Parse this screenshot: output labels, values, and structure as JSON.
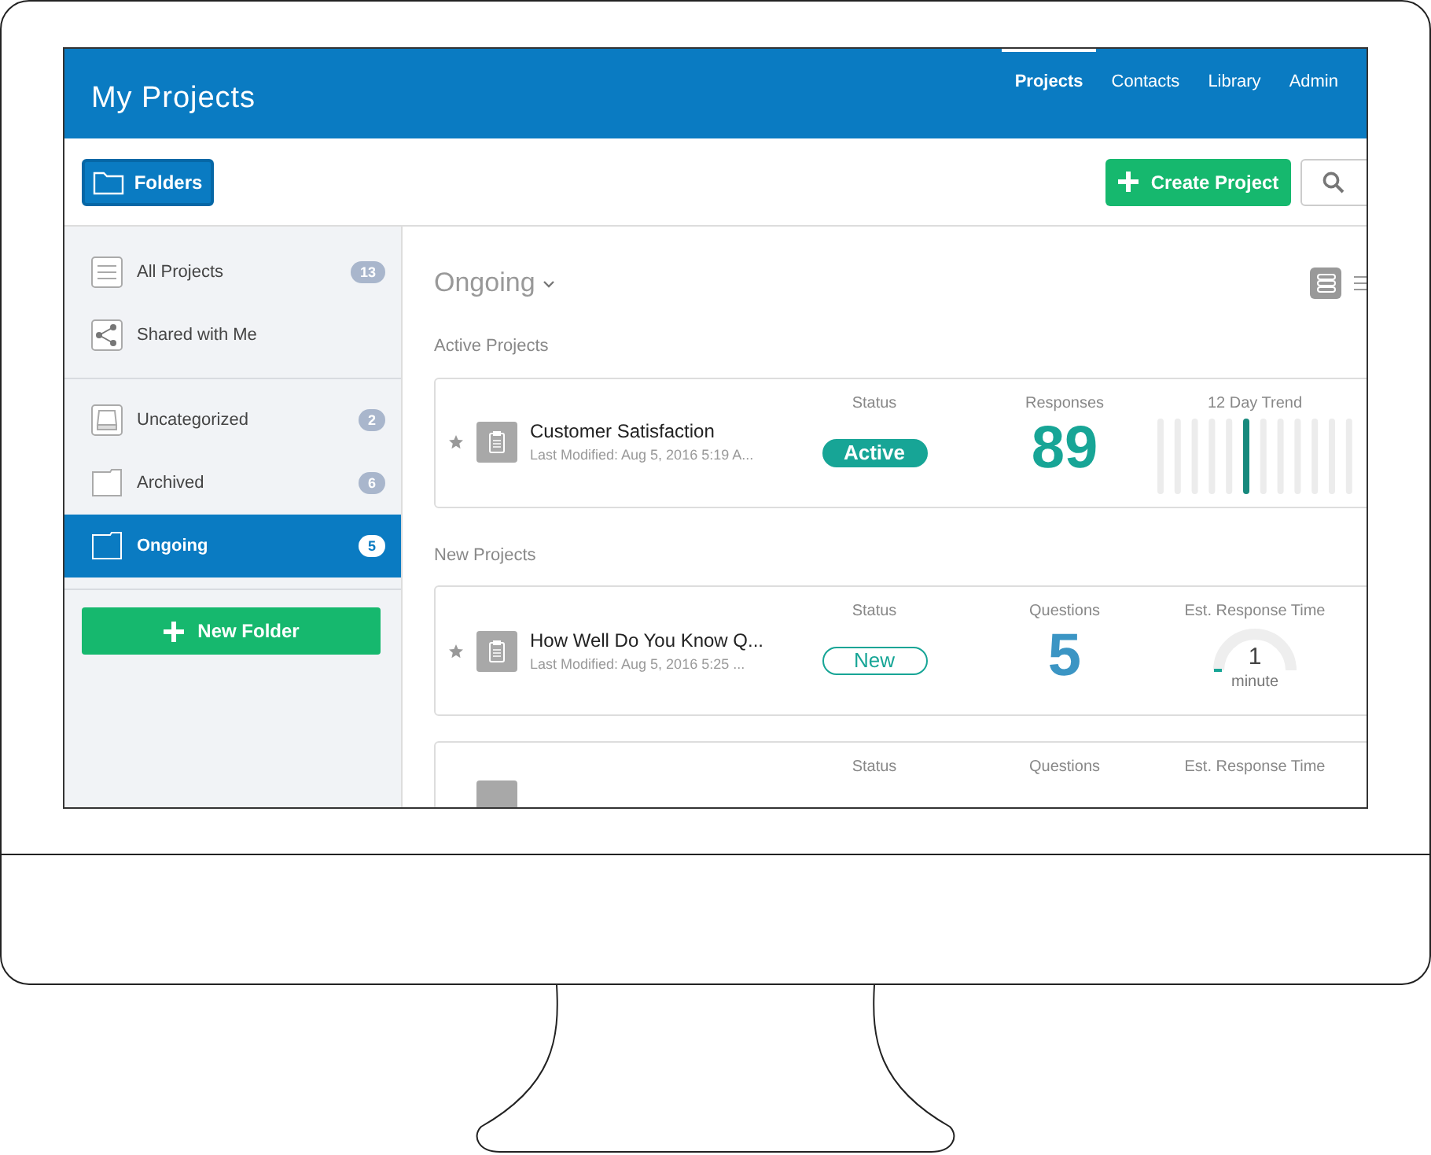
{
  "header": {
    "title": "My Projects",
    "nav": [
      {
        "label": "Projects",
        "selected": true
      },
      {
        "label": "Contacts",
        "selected": false
      },
      {
        "label": "Library",
        "selected": false
      },
      {
        "label": "Admin",
        "selected": false
      }
    ]
  },
  "toolbar": {
    "folders_button": "Folders",
    "create_button": "Create Project"
  },
  "sidebar": {
    "groups": [
      [
        {
          "label": "All Projects",
          "kind": "list",
          "count": "13",
          "selected": false
        },
        {
          "label": "Shared with Me",
          "kind": "share",
          "selected": false
        }
      ],
      [
        {
          "label": "Uncategorized",
          "kind": "tray",
          "count": "2",
          "selected": false
        },
        {
          "label": "Archived",
          "kind": "folder",
          "count": "6",
          "selected": false
        },
        {
          "label": "Ongoing",
          "kind": "folder",
          "count": "5",
          "selected": true
        }
      ]
    ],
    "new_folder_button": "New Folder"
  },
  "main": {
    "folder_title": "Ongoing",
    "sections": [
      {
        "title": "Active Projects",
        "projects": [
          {
            "name": "Customer Satisfaction",
            "modified": "Last Modified: Aug 5, 2016 5:19 A...",
            "status": {
              "label": "Status",
              "value": "Active",
              "kind": "active"
            },
            "metric": {
              "label": "Responses",
              "value": "89",
              "kind": "responses"
            },
            "extra": {
              "label": "12 Day Trend",
              "kind": "trend"
            }
          }
        ]
      },
      {
        "title": "New Projects",
        "projects": [
          {
            "name": "How Well Do You Know Q...",
            "modified": "Last Modified: Aug 5, 2016 5:25 ...",
            "status": {
              "label": "Status",
              "value": "New",
              "kind": "new"
            },
            "metric": {
              "label": "Questions",
              "value": "5",
              "kind": "questions"
            },
            "extra": {
              "label": "Est. Response Time",
              "kind": "time",
              "value": "1",
              "unit": "minute"
            }
          },
          {
            "status": {
              "label": "Status"
            },
            "metric": {
              "label": "Questions"
            },
            "extra": {
              "label": "Est. Response Time"
            }
          }
        ]
      }
    ]
  }
}
